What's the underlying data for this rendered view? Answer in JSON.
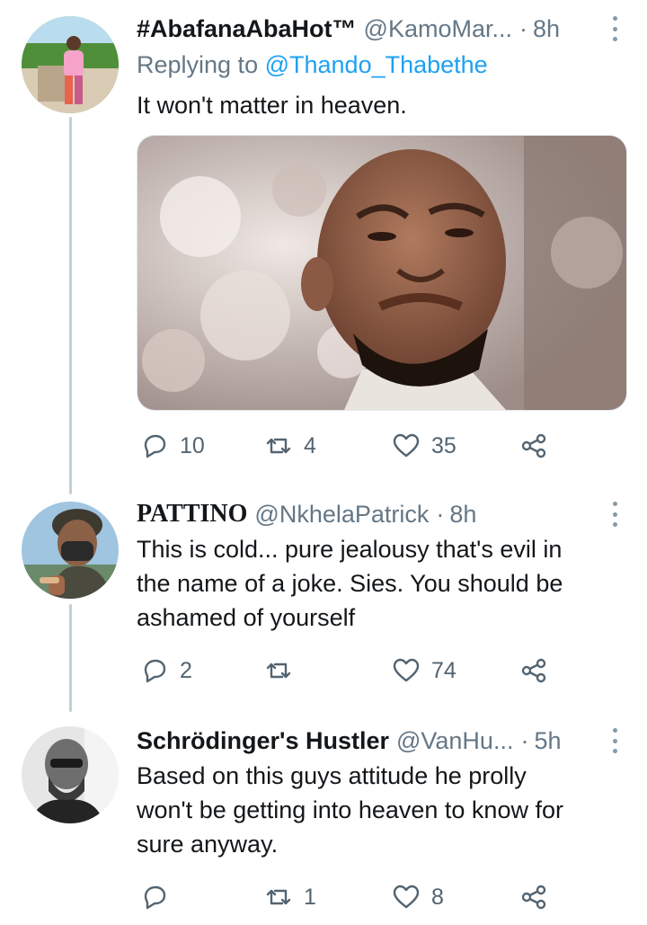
{
  "tweets": [
    {
      "name": "#AbafanaAbaHot™",
      "handle": "@KamoMar...",
      "separator": "·",
      "time": "8h",
      "replying_prefix": "Replying to",
      "replying_to": "@Thando_Thabethe",
      "text": "It won't matter in heaven.",
      "replies": "10",
      "retweets": "4",
      "likes": "35"
    },
    {
      "name": "PATTINO",
      "handle": "@NkhelaPatrick",
      "separator": "·",
      "time": "8h",
      "text_lines": [
        "This is cold... pure jealousy that's evil in",
        "the name of a joke. Sies. You should be",
        "ashamed of yourself"
      ],
      "replies": "2",
      "retweets": "",
      "likes": "74"
    },
    {
      "name": "Schrödinger's Hustler",
      "handle": "@VanHu...",
      "separator": "·",
      "time": "5h",
      "text_lines": [
        "Based on this guys attitude he prolly",
        "won't be getting into heaven to know for",
        "sure anyway."
      ],
      "replies": "",
      "retweets": "1",
      "likes": "8"
    }
  ],
  "icons": [
    "reply-icon",
    "retweet-icon",
    "like-icon",
    "share-icon",
    "more-icon"
  ],
  "colors": {
    "link": "#1da1f2",
    "secondary": "#657786",
    "thread_line": "#c4cfd6"
  }
}
